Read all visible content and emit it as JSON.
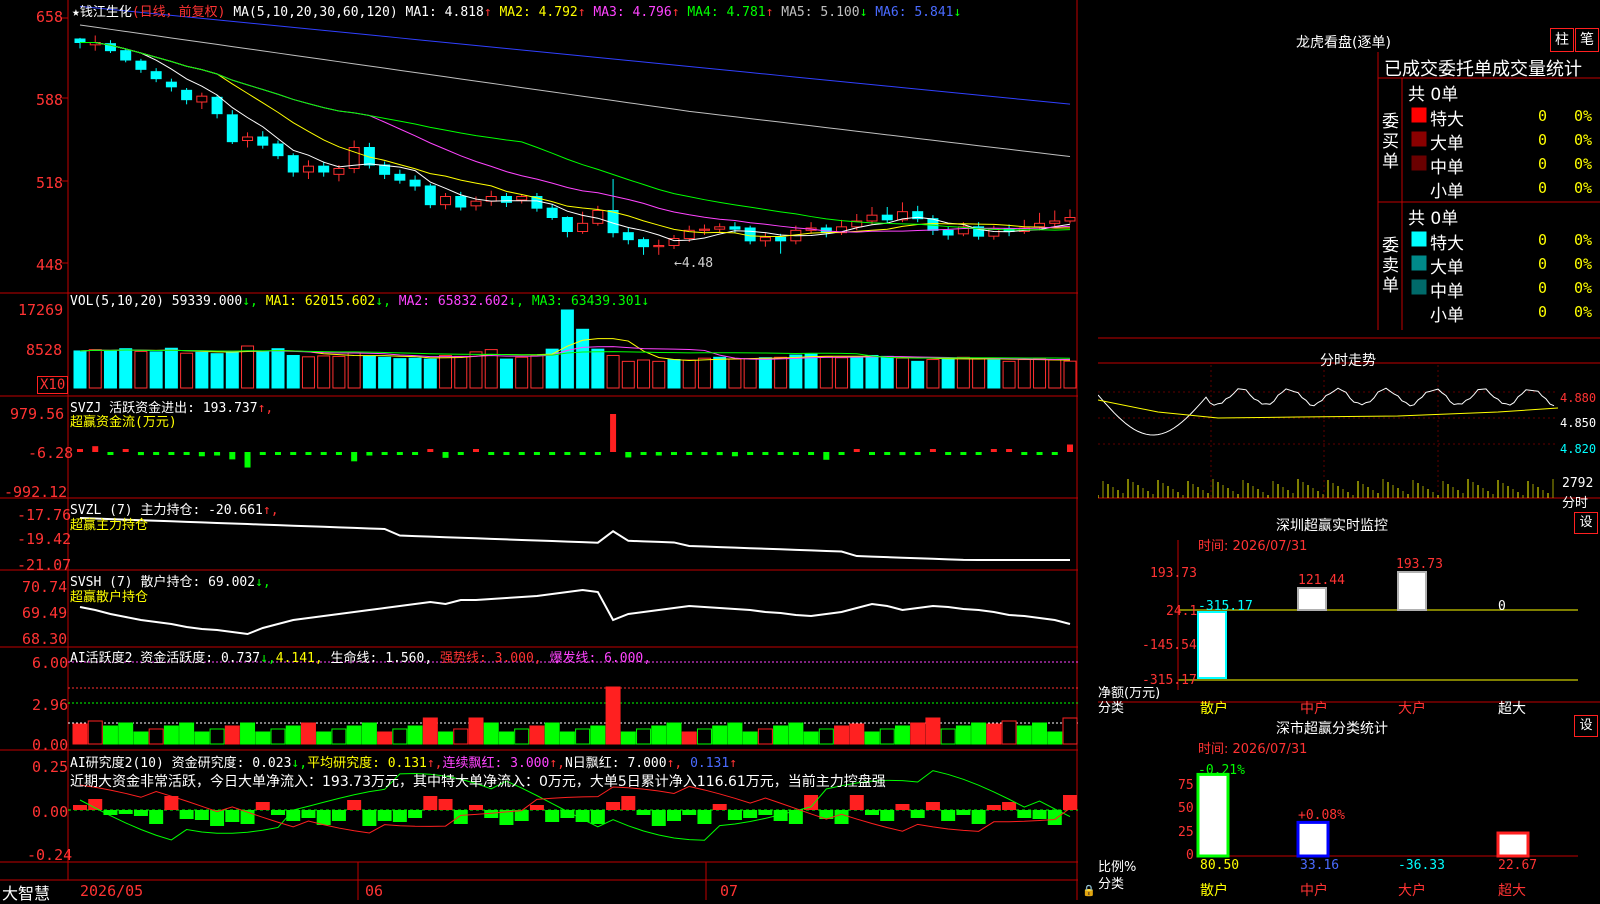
{
  "stock": {
    "name": "钱江生化",
    "mode": "(日线，前复权)",
    "ma_header": "MA(5,10,20,30,60,120)",
    "ma": [
      {
        "label": "MA1:",
        "value": "4.818",
        "arrow": "↑",
        "color": "#ffffff"
      },
      {
        "label": "MA2:",
        "value": "4.792",
        "arrow": "↑",
        "color": "#ffff00"
      },
      {
        "label": "MA3:",
        "value": "4.796",
        "arrow": "↑",
        "color": "#ff44ff"
      },
      {
        "label": "MA4:",
        "value": "4.781",
        "arrow": "↑",
        "color": "#00ff00"
      },
      {
        "label": "MA5:",
        "value": "5.100",
        "arrow": "↓",
        "color": "#c0c0c0"
      },
      {
        "label": "MA6:",
        "value": "5.841",
        "arrow": "↓",
        "color": "#4a6bff"
      }
    ],
    "price_axis": [
      "658",
      "588",
      "518",
      "448"
    ],
    "low_marker": "←4.48"
  },
  "vol": {
    "header": "VOL(5,10,20)",
    "value": "59339.000",
    "ma1": "MA1: 62015.602",
    "ma2": "MA2: 65832.602",
    "ma3": "MA3: 63439.301",
    "axis": [
      "17269",
      "8528"
    ],
    "unit": "X10"
  },
  "svzj": {
    "header": "SVZJ  活跃资金进出: 193.737",
    "arrow": "↑,",
    "sub": "超赢资金流(万元)",
    "axis": [
      "979.56",
      "-6.28",
      "-992.12"
    ]
  },
  "svzl": {
    "header": "SVZL (7) 主力持仓: -20.661",
    "arrow": "↑,",
    "sub": "超赢主力持仓",
    "axis": [
      "-17.76",
      "-19.42",
      "-21.07"
    ]
  },
  "svsh": {
    "header": "SVSH (7) 散户持仓: 69.002",
    "arrow": "↓,",
    "sub": "超赢散户持仓",
    "axis": [
      "70.74",
      "69.49",
      "68.30"
    ]
  },
  "ai_active": {
    "header": "AI活跃度2 资金活跃度: 0.737",
    "a1": "↓,",
    "v2": "4.141,",
    "life": "生命线: 1.560,",
    "strong": "强势线: 3.000,",
    "burst": "爆发线: 6.000,",
    "axis": [
      "6.00",
      "2.96",
      "0.00"
    ]
  },
  "ai_research": {
    "header": "AI研究度2(10) 资金研究度: 0.023",
    "a1": "↓,",
    "avg": "平均研究度: 0.131",
    "a2": "↑,",
    "red_days": "连续飘红: 3.000",
    "a3": "↑,",
    "n_days": "N日飘红: 7.000",
    "a4": "↑,",
    "last": "0.131",
    "a5": "↑",
    "comment": "近期大资金非常活跃，今日大单净流入：193.73万元，其中特大单净流入：0万元，大单5日累计净入116.61万元，当前主力控盘强",
    "axis": [
      "0.25",
      "0.00",
      "-0.24"
    ]
  },
  "bottom": {
    "brand": "大智慧",
    "dates": [
      "2026/05",
      "06",
      "07"
    ]
  },
  "dragon": {
    "title": "龙虎看盘(逐单)",
    "btn1": "柱",
    "btn2": "笔",
    "tab_header": "已成交委托单成交量统计",
    "buy_label": "委买单",
    "sell_label": "委卖单",
    "buy_total": "共 0单",
    "sell_total": "共 0单",
    "buy_rows": [
      {
        "name": "特大",
        "count": "0",
        "pct": "0%",
        "color": "#ff0000"
      },
      {
        "name": "大单",
        "count": "0",
        "pct": "0%",
        "color": "#8a0000"
      },
      {
        "name": "中单",
        "count": "0",
        "pct": "0%",
        "color": "#6a0000"
      },
      {
        "name": "小单",
        "count": "0",
        "pct": "0%",
        "color": "#000000"
      }
    ],
    "sell_rows": [
      {
        "name": "特大",
        "count": "0",
        "pct": "0%",
        "color": "#00ffff"
      },
      {
        "name": "大单",
        "count": "0",
        "pct": "0%",
        "color": "#008a8a"
      },
      {
        "name": "中单",
        "count": "0",
        "pct": "0%",
        "color": "#006a6a"
      },
      {
        "name": "小单",
        "count": "0",
        "pct": "0%",
        "color": "#000000"
      }
    ]
  },
  "intraday": {
    "title": "分时走势",
    "axis": [
      "4.880",
      "4.850",
      "4.820"
    ],
    "vol_axis": "2792",
    "vol_label": "分时"
  },
  "sz_monitor": {
    "title": "深圳超赢实时监控",
    "time": "时间: 2026/07/31",
    "set": "设",
    "axis": [
      "193.73",
      "24.1",
      "-145.54",
      "-315.17"
    ],
    "net_label": "净额(万元)",
    "cat_label": "分类",
    "categories": [
      "散户",
      "中户",
      "大户",
      "超大"
    ],
    "values": [
      "-315.17",
      "121.44",
      "193.73",
      "0"
    ]
  },
  "sz_stat": {
    "title": "深市超赢分类统计",
    "time": "时间: 2026/07/31",
    "set": "设",
    "axis": [
      "75",
      "50",
      "25",
      "0"
    ],
    "ratio_label": "比例%",
    "cat_label": "分类",
    "categories": [
      "散户",
      "中户",
      "大户",
      "超大"
    ],
    "top_labels": [
      "-0.21%",
      "+0.08%"
    ],
    "values": [
      "80.50",
      "33.16",
      "-36.33",
      "22.67"
    ],
    "bar_levels": [
      80.5,
      33.16,
      0,
      22.67
    ]
  },
  "chart_data": {
    "type": "candlestick",
    "candles": [
      [
        640,
        637,
        641,
        632
      ],
      [
        635,
        637,
        643,
        630
      ],
      [
        636,
        630,
        639,
        628
      ],
      [
        630,
        622,
        631,
        620
      ],
      [
        621,
        614,
        623,
        611
      ],
      [
        612,
        606,
        615,
        603
      ],
      [
        603,
        599,
        606,
        595
      ],
      [
        596,
        588,
        598,
        584
      ],
      [
        586,
        591,
        594,
        580
      ],
      [
        590,
        576,
        592,
        572
      ],
      [
        575,
        552,
        579,
        550
      ],
      [
        553,
        556,
        560,
        547
      ],
      [
        556,
        549,
        561,
        546
      ],
      [
        550,
        540,
        553,
        537
      ],
      [
        540,
        526,
        542,
        522
      ],
      [
        526,
        531,
        536,
        520
      ],
      [
        531,
        526,
        535,
        522
      ],
      [
        524,
        529,
        532,
        518
      ],
      [
        529,
        547,
        553,
        525
      ],
      [
        547,
        532,
        551,
        529
      ],
      [
        532,
        524,
        535,
        520
      ],
      [
        524,
        519,
        528,
        516
      ],
      [
        519,
        514,
        523,
        510
      ],
      [
        514,
        498,
        516,
        495
      ],
      [
        498,
        505,
        508,
        494
      ],
      [
        505,
        496,
        509,
        493
      ],
      [
        497,
        501,
        505,
        493
      ],
      [
        501,
        505,
        510,
        497
      ],
      [
        505,
        500,
        508,
        496
      ],
      [
        502,
        505,
        507,
        499
      ],
      [
        505,
        495,
        508,
        492
      ],
      [
        495,
        487,
        498,
        485
      ],
      [
        487,
        475,
        488,
        470
      ],
      [
        475,
        482,
        492,
        473
      ],
      [
        482,
        493,
        497,
        480
      ],
      [
        493,
        474,
        520,
        470
      ],
      [
        474,
        468,
        478,
        464
      ],
      [
        468,
        462,
        470,
        455
      ],
      [
        462,
        463,
        468,
        455
      ],
      [
        463,
        469,
        472,
        460
      ],
      [
        469,
        476,
        480,
        466
      ],
      [
        476,
        477,
        481,
        472
      ],
      [
        477,
        479,
        482,
        474
      ],
      [
        479,
        477,
        483,
        474
      ],
      [
        478,
        467,
        480,
        464
      ],
      [
        467,
        470,
        474,
        462
      ],
      [
        470,
        467,
        473,
        456
      ],
      [
        467,
        476,
        480,
        464
      ],
      [
        476,
        478,
        483,
        473
      ],
      [
        478,
        474,
        481,
        470
      ],
      [
        474,
        479,
        485,
        472
      ],
      [
        479,
        484,
        490,
        476
      ],
      [
        484,
        489,
        496,
        481
      ],
      [
        489,
        485,
        496,
        482
      ],
      [
        485,
        492,
        500,
        483
      ],
      [
        492,
        486,
        497,
        483
      ],
      [
        486,
        476,
        489,
        472
      ],
      [
        476,
        472,
        479,
        468
      ],
      [
        473,
        479,
        483,
        471
      ],
      [
        479,
        471,
        483,
        468
      ],
      [
        471,
        477,
        480,
        468
      ],
      [
        477,
        475,
        481,
        471
      ],
      [
        475,
        478,
        485,
        473
      ],
      [
        479,
        482,
        491,
        476
      ],
      [
        482,
        484,
        493,
        479
      ],
      [
        484,
        487,
        494,
        482
      ]
    ],
    "volume": [
      [
        8200,
        1
      ],
      [
        8500,
        0
      ],
      [
        8300,
        1
      ],
      [
        8700,
        1
      ],
      [
        8100,
        0
      ],
      [
        8000,
        1
      ],
      [
        8800,
        1
      ],
      [
        7700,
        0
      ],
      [
        7900,
        1
      ],
      [
        7600,
        1
      ],
      [
        7900,
        1
      ],
      [
        9300,
        0
      ],
      [
        8000,
        1
      ],
      [
        8700,
        1
      ],
      [
        7200,
        1
      ],
      [
        6900,
        0
      ],
      [
        7100,
        0
      ],
      [
        7000,
        0
      ],
      [
        7800,
        0
      ],
      [
        7100,
        1
      ],
      [
        6800,
        1
      ],
      [
        6500,
        1
      ],
      [
        6600,
        1
      ],
      [
        6400,
        1
      ],
      [
        7200,
        0
      ],
      [
        7000,
        0
      ],
      [
        8000,
        0
      ],
      [
        8500,
        0
      ],
      [
        6400,
        1
      ],
      [
        6800,
        0
      ],
      [
        7200,
        0
      ],
      [
        8600,
        1
      ],
      [
        17269,
        1
      ],
      [
        13000,
        1
      ],
      [
        8600,
        1
      ],
      [
        7200,
        0
      ],
      [
        5900,
        0
      ],
      [
        6200,
        0
      ],
      [
        5900,
        0
      ],
      [
        6300,
        1
      ],
      [
        6200,
        0
      ],
      [
        6600,
        0
      ],
      [
        6800,
        1
      ],
      [
        6400,
        0
      ],
      [
        6500,
        0
      ],
      [
        6700,
        1
      ],
      [
        6800,
        0
      ],
      [
        7300,
        1
      ],
      [
        7500,
        1
      ],
      [
        6900,
        0
      ],
      [
        6700,
        0
      ],
      [
        6800,
        1
      ],
      [
        7200,
        1
      ],
      [
        7000,
        1
      ],
      [
        6600,
        0
      ],
      [
        5900,
        1
      ],
      [
        6300,
        0
      ],
      [
        6600,
        1
      ],
      [
        6800,
        0
      ],
      [
        6500,
        0
      ],
      [
        6200,
        1
      ],
      [
        5900,
        0
      ],
      [
        6300,
        0
      ],
      [
        6500,
        0
      ],
      [
        6200,
        0
      ],
      [
        5939,
        0
      ]
    ],
    "money_flow": [
      40,
      150,
      -40,
      0,
      -80,
      -10,
      -10,
      -70,
      -110,
      -90,
      -190,
      -400,
      -30,
      -40,
      -20,
      -30,
      -50,
      -20,
      -240,
      -90,
      -20,
      -60,
      -30,
      10,
      -150,
      -10,
      40,
      -30,
      -50,
      -20,
      -40,
      -60,
      -30,
      -60,
      -10,
      979,
      -140,
      -40,
      -90,
      -20,
      -40,
      -10,
      -80,
      -110,
      -30,
      -40,
      -20,
      -10,
      -50,
      -200,
      -10,
      50,
      -40,
      -20,
      -80,
      -30,
      30,
      -20,
      -40,
      -10,
      40,
      30,
      -30,
      -70,
      -50,
      193
    ]
  }
}
